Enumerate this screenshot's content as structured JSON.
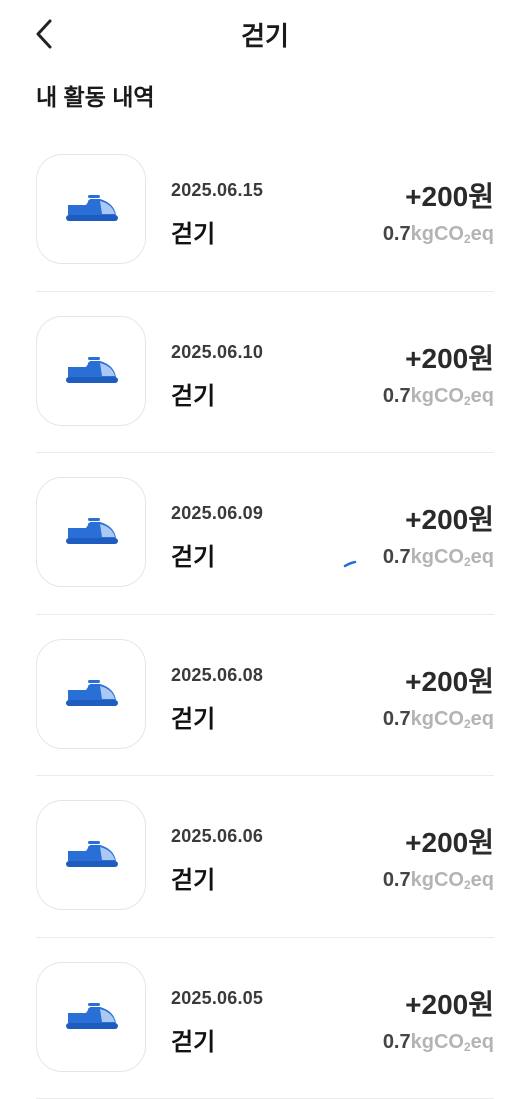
{
  "header": {
    "title": "걷기",
    "back_icon": "chevron-left-icon"
  },
  "section_title": "내 활동 내역",
  "colors": {
    "shoe_blue": "#2a6fd6",
    "shoe_light": "#8fb6ef",
    "muted_gray": "#b4b4b4"
  },
  "activities": [
    {
      "date": "2025.06.15",
      "name": "걷기",
      "reward": "+200원",
      "carbon_value": "0.7",
      "carbon_unit": "kgCO",
      "carbon_sub": "2",
      "carbon_suffix": "eq",
      "icon": "sneaker-icon"
    },
    {
      "date": "2025.06.10",
      "name": "걷기",
      "reward": "+200원",
      "carbon_value": "0.7",
      "carbon_unit": "kgCO",
      "carbon_sub": "2",
      "carbon_suffix": "eq",
      "icon": "sneaker-icon"
    },
    {
      "date": "2025.06.09",
      "name": "걷기",
      "reward": "+200원",
      "carbon_value": "0.7",
      "carbon_unit": "kgCO",
      "carbon_sub": "2",
      "carbon_suffix": "eq",
      "icon": "sneaker-icon"
    },
    {
      "date": "2025.06.08",
      "name": "걷기",
      "reward": "+200원",
      "carbon_value": "0.7",
      "carbon_unit": "kgCO",
      "carbon_sub": "2",
      "carbon_suffix": "eq",
      "icon": "sneaker-icon"
    },
    {
      "date": "2025.06.06",
      "name": "걷기",
      "reward": "+200원",
      "carbon_value": "0.7",
      "carbon_unit": "kgCO",
      "carbon_sub": "2",
      "carbon_suffix": "eq",
      "icon": "sneaker-icon"
    },
    {
      "date": "2025.06.05",
      "name": "걷기",
      "reward": "+200원",
      "carbon_value": "0.7",
      "carbon_unit": "kgCO",
      "carbon_sub": "2",
      "carbon_suffix": "eq",
      "icon": "sneaker-icon"
    }
  ]
}
